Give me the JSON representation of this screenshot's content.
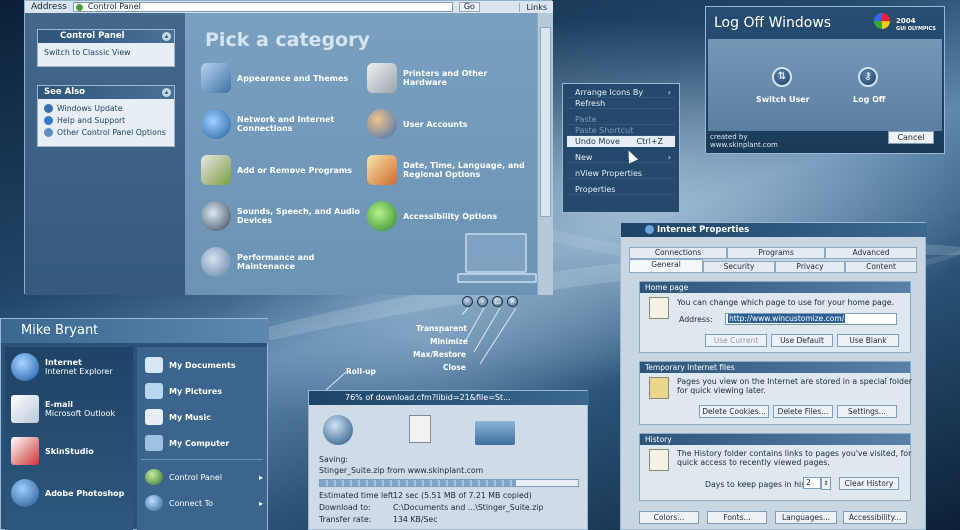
{
  "address": {
    "label": "Address",
    "value": "Control Panel",
    "go": "Go",
    "links": "Links"
  },
  "control_panel": {
    "task_title": "Control Panel",
    "switch_view": "Switch to Classic View",
    "see_also_title": "See Also",
    "see_also": [
      "Windows Update",
      "Help and Support",
      "Other Control Panel Options"
    ],
    "heading": "Pick a category",
    "categories": [
      "Appearance and Themes",
      "Printers and Other Hardware",
      "Network and Internet Connections",
      "User Accounts",
      "Add or Remove Programs",
      "Date, Time, Language, and Regional Options",
      "Sounds, Speech, and Audio Devices",
      "Accessibility Options",
      "Performance and Maintenance"
    ]
  },
  "callouts": {
    "transparent": "Transparent",
    "minimize": "Minimize",
    "max_restore": "Max/Restore",
    "close": "Close",
    "rollup": "Roll-up"
  },
  "context_menu": {
    "arrange": "Arrange Icons By",
    "refresh": "Refresh",
    "paste": "Paste",
    "paste_shortcut": "Paste Shortcut",
    "undo_move": "Undo Move",
    "undo_shortcut": "Ctrl+Z",
    "new": "New",
    "nview": "nView Properties",
    "properties": "Properties"
  },
  "logoff": {
    "title": "Log Off Windows",
    "brand_line1": "2004",
    "brand_line2": "GUI OLYMPICS",
    "switch_user": "Switch User",
    "log_off": "Log Off",
    "credit1": "created by",
    "credit2": "www.skinplant.com",
    "cancel": "Cancel"
  },
  "internet_properties": {
    "title": "Internet Properties",
    "tabs_back": [
      "Connections",
      "Programs",
      "Advanced"
    ],
    "tabs_front": [
      "General",
      "Security",
      "Privacy",
      "Content"
    ],
    "home_title": "Home page",
    "home_text": "You can change which page to use for your home page.",
    "address_label": "Address:",
    "address_value": "http://www.wincustomize.com/",
    "use_current": "Use Current",
    "use_default": "Use Default",
    "use_blank": "Use Blank",
    "temp_title": "Temporary Internet files",
    "temp_text1": "Pages you view on the Internet are stored in a special folder",
    "temp_text2": "for quick viewing later.",
    "delete_cookies": "Delete Cookies...",
    "delete_files": "Delete Files...",
    "settings": "Settings...",
    "history_title": "History",
    "history_text1": "The History folder contains links to pages you've visited, for",
    "history_text2": "quick access to recently viewed pages.",
    "days_label": "Days to keep pages in history:",
    "days_value": "2",
    "clear_history": "Clear History",
    "colors": "Colors...",
    "fonts": "Fonts...",
    "languages": "Languages...",
    "accessibility": "Accessibility..."
  },
  "download": {
    "title": "76% of download.cfm?libid=21&file=St...",
    "saving": "Saving:",
    "file": "Stinger_Suite.zip from www.skinplant.com",
    "progress": 0.76,
    "eta_label": "Estimated time left",
    "eta_value": "12 sec (5.51 MB of 7.21 MB copied)",
    "dest_label": "Download to:",
    "dest_value": "C:\\Documents and ...\\Stinger_Suite.zip",
    "rate_label": "Transfer rate:",
    "rate_value": "134 KB/Sec"
  },
  "start_menu": {
    "user": "Mike Bryant",
    "pinned": [
      {
        "title": "Internet",
        "sub": "Internet Explorer"
      },
      {
        "title": "E-mail",
        "sub": "Microsoft Outlook"
      },
      {
        "title": "SkinStudio",
        "sub": ""
      },
      {
        "title": "Adobe Photoshop",
        "sub": ""
      }
    ],
    "places": [
      "My Documents",
      "My Pictures",
      "My Music",
      "My Computer"
    ],
    "control_panel": "Control Panel",
    "connect_to": "Connect To"
  }
}
